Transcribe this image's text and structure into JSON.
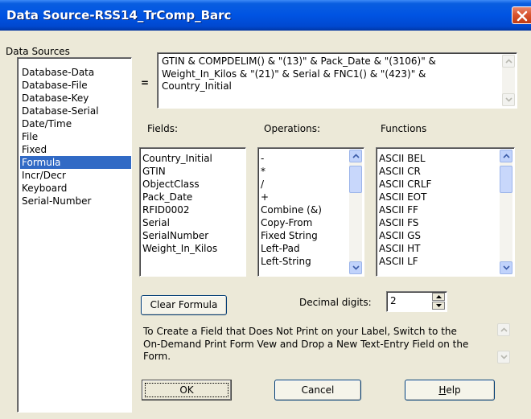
{
  "window": {
    "title": "Data Source-RSS14_TrComp_Barc"
  },
  "data_sources": {
    "caption": "Data Sources",
    "items": [
      "Database-Data",
      "Database-File",
      "Database-Key",
      "Database-Serial",
      "Date/Time",
      "File",
      "Fixed",
      "Formula",
      "Incr/Decr",
      "Keyboard",
      "Serial-Number"
    ],
    "selected": "Formula"
  },
  "formula": {
    "equals": "=",
    "lines": [
      "GTIN & COMPDELIM() & \"(13)\" & Pack_Date & \"(3106)\" &",
      "Weight_In_Kilos & \"(21)\" & Serial & FNC1() & \"(423)\" &",
      "Country_Initial"
    ]
  },
  "fields": {
    "label": "Fields:",
    "items": [
      "Country_Initial",
      "GTIN",
      "ObjectClass",
      "Pack_Date",
      "RFID0002",
      "Serial",
      "SerialNumber",
      "Weight_In_Kilos"
    ]
  },
  "operations": {
    "label": "Operations:",
    "items": [
      "-",
      "*",
      "/",
      "+",
      "Combine (&)",
      "Copy-From",
      "Fixed String",
      "Left-Pad",
      "Left-String"
    ]
  },
  "functions": {
    "label": "Functions",
    "items": [
      "ASCII BEL",
      "ASCII CR",
      "ASCII CRLF",
      "ASCII EOT",
      "ASCII FF",
      "ASCII FS",
      "ASCII GS",
      "ASCII HT",
      "ASCII LF"
    ]
  },
  "buttons": {
    "clear_formula": "Clear Formula",
    "ok": "OK",
    "cancel": "Cancel",
    "help": "Help"
  },
  "decimal": {
    "label": "Decimal digits:",
    "value": "2"
  },
  "note": {
    "lines": [
      "To Create a Field that Does Not Print on your Label, Switch to the",
      "On-Demand Print Form Vew and Drop a New Text-Entry Field on the",
      "Form."
    ]
  },
  "colors": {
    "title_bar": "#0054e3",
    "selection": "#316ac5",
    "dialog_bg": "#ece9d8"
  }
}
